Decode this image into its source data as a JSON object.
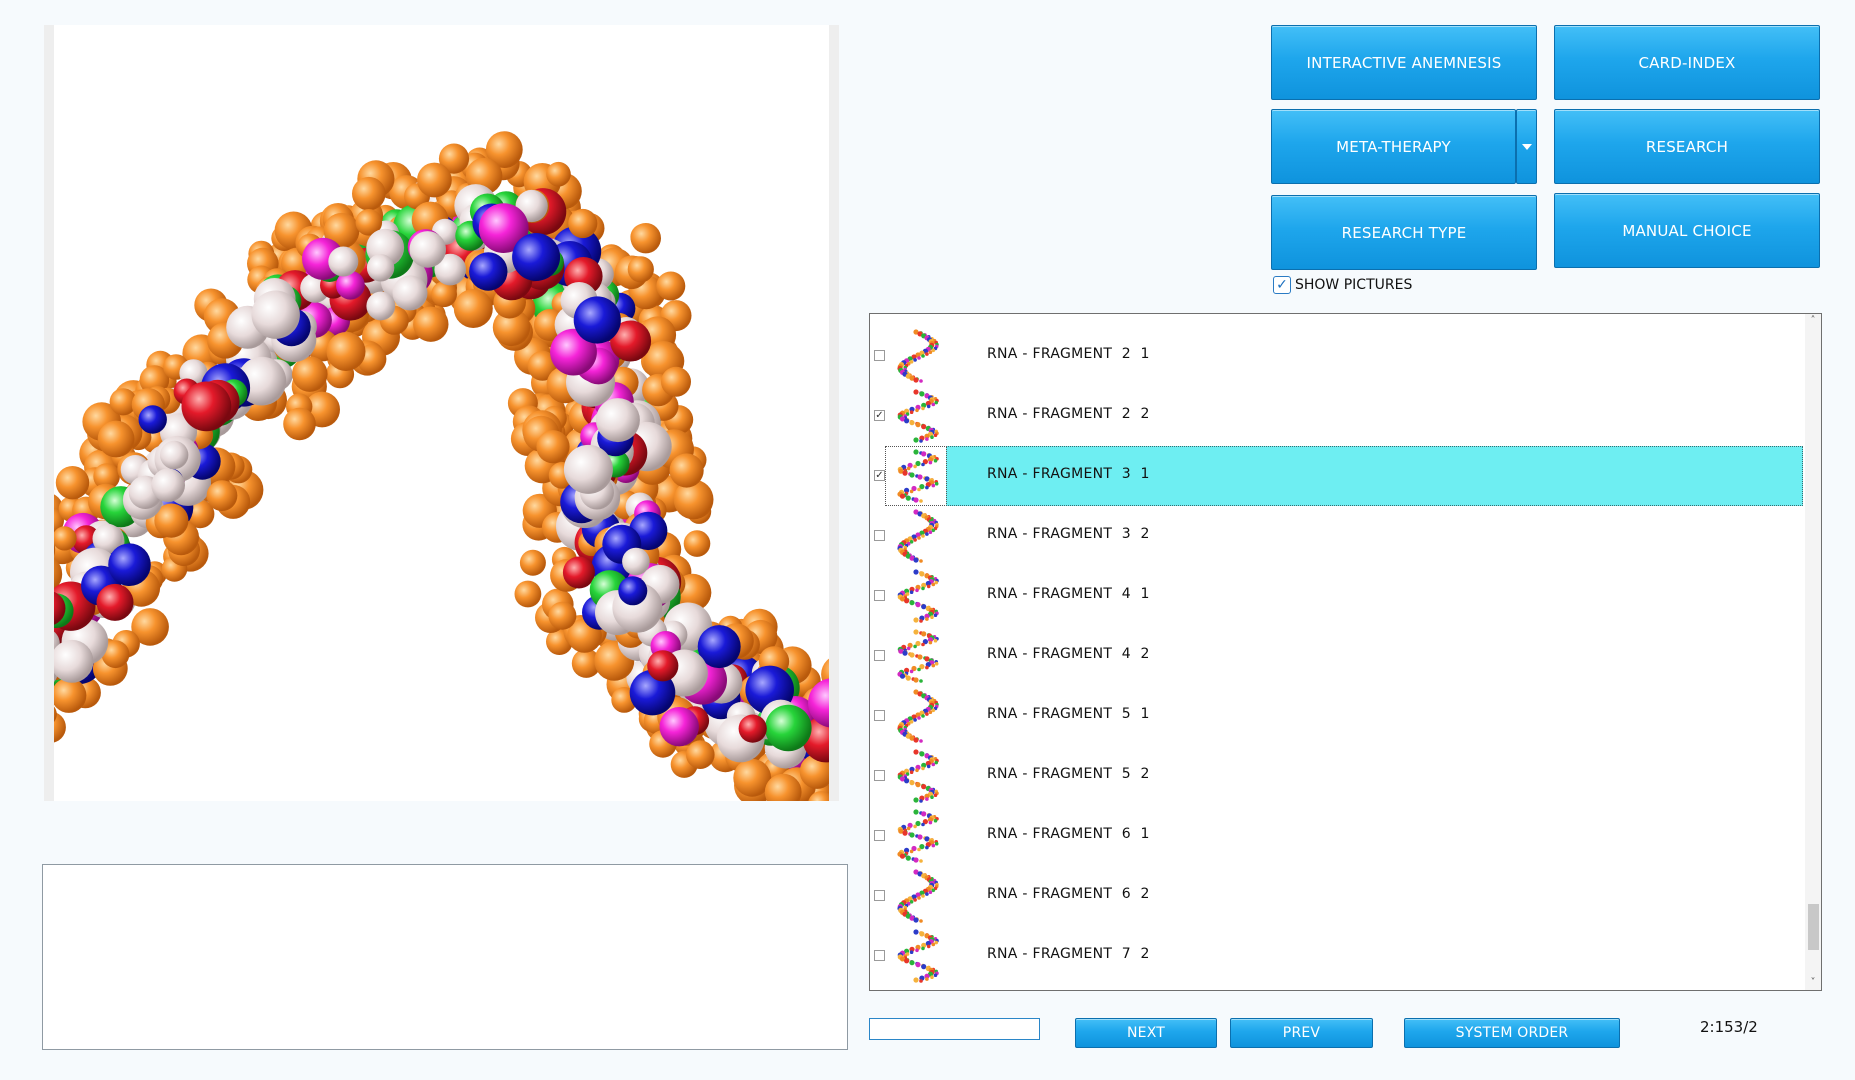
{
  "buttons": {
    "interactive_anemnesis": "INTERACTIVE ANEMNESIS",
    "card_index": "CARD-INDEX",
    "meta_therapy": "META-THERAPY",
    "research": "RESEARCH",
    "research_type": "RESEARCH TYPE",
    "manual_choice": "MANUAL CHOICE",
    "next": "NEXT",
    "prev": "PREV",
    "system_order": "SYSTEM ORDER"
  },
  "show_pictures": {
    "label": "SHOW PICTURES",
    "checked": true
  },
  "list": {
    "items": [
      {
        "label": "RNA - FRAGMENT  2  1",
        "checked": false,
        "selected": false
      },
      {
        "label": "RNA - FRAGMENT  2  2",
        "checked": true,
        "selected": false
      },
      {
        "label": "RNA - FRAGMENT  3  1",
        "checked": true,
        "selected": true
      },
      {
        "label": "RNA - FRAGMENT  3  2",
        "checked": false,
        "selected": false
      },
      {
        "label": "RNA - FRAGMENT  4  1",
        "checked": false,
        "selected": false
      },
      {
        "label": "RNA - FRAGMENT  4  2",
        "checked": false,
        "selected": false
      },
      {
        "label": "RNA - FRAGMENT  5  1",
        "checked": false,
        "selected": false
      },
      {
        "label": "RNA - FRAGMENT  5  2",
        "checked": false,
        "selected": false
      },
      {
        "label": "RNA - FRAGMENT  6  1",
        "checked": false,
        "selected": false
      },
      {
        "label": "RNA - FRAGMENT  6  2",
        "checked": false,
        "selected": false
      },
      {
        "label": "RNA - FRAGMENT  7  2",
        "checked": false,
        "selected": false
      }
    ],
    "selected_color": "#6eeef2"
  },
  "search": {
    "value": ""
  },
  "counter": "2:153/2",
  "colors": {
    "button": "#1ea6ec",
    "background": "#f6fafd"
  },
  "icons": {
    "dropdown": "chevron-down-icon",
    "scroll_up": "chevron-up-icon",
    "scroll_down": "chevron-down-icon",
    "check": "check-icon"
  }
}
